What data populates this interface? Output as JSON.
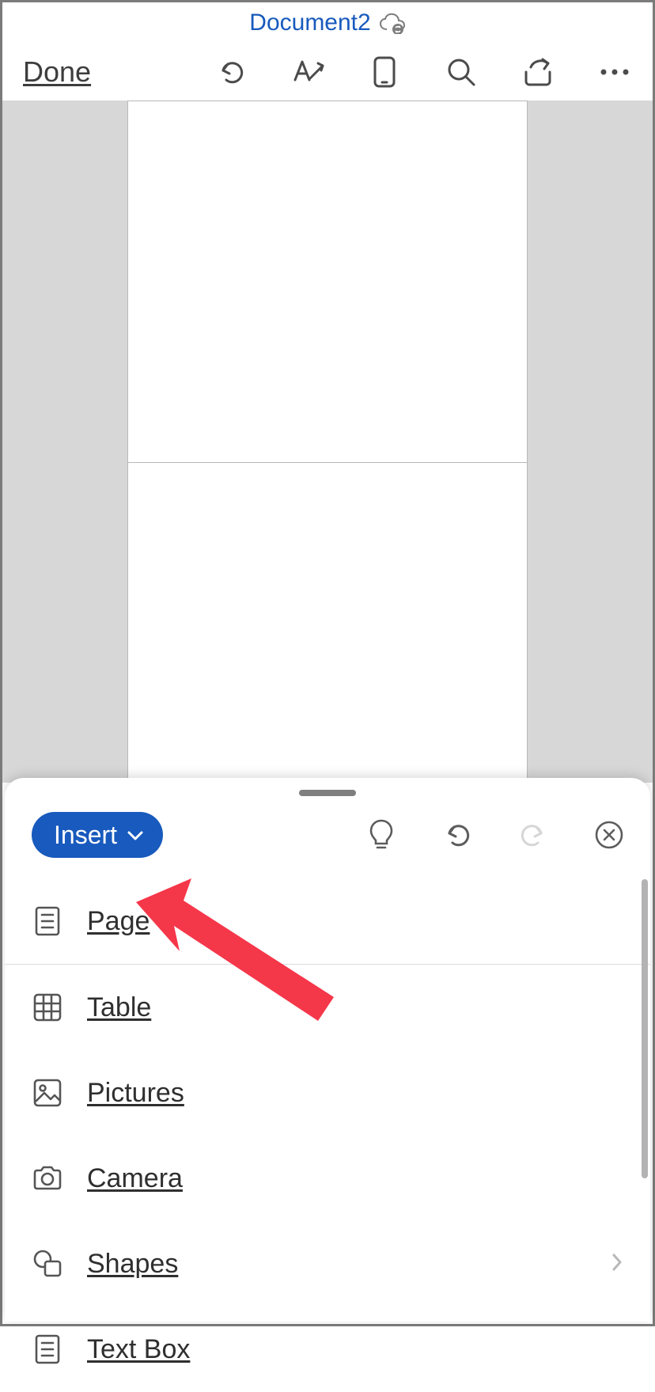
{
  "title": {
    "document_name": "Document2"
  },
  "toolbar": {
    "done_label": "Done"
  },
  "sheet": {
    "tab_label": "Insert",
    "menu": [
      {
        "label": "Page"
      },
      {
        "label": "Table"
      },
      {
        "label": "Pictures"
      },
      {
        "label": "Camera"
      },
      {
        "label": "Shapes"
      },
      {
        "label": "Text Box"
      }
    ]
  },
  "colors": {
    "accent": "#185abd"
  }
}
